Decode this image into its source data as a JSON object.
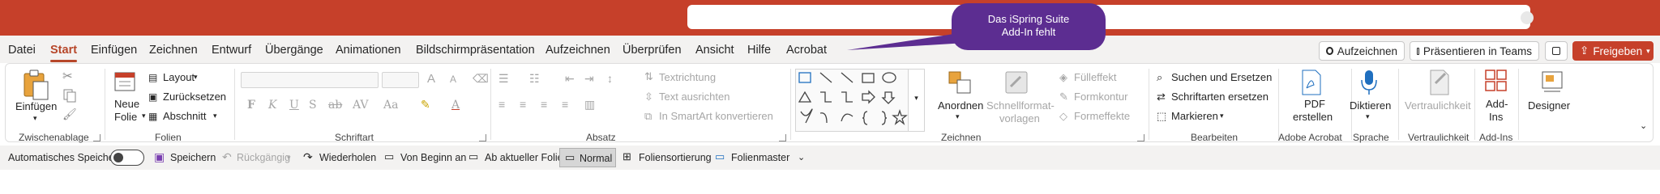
{
  "callout": {
    "line1": "Das iSpring Suite",
    "line2": "Add-In fehlt"
  },
  "tabs": [
    "Datei",
    "Start",
    "Einfügen",
    "Zeichnen",
    "Entwurf",
    "Übergänge",
    "Animationen",
    "Bildschirmpräsentation",
    "Aufzeichnen",
    "Überprüfen",
    "Ansicht",
    "Hilfe",
    "Acrobat"
  ],
  "active_tab": "Start",
  "top_buttons": {
    "record": "Aufzeichnen",
    "present_teams": "Präsentieren in Teams",
    "share": "Freigeben"
  },
  "groups": {
    "clipboard": {
      "label": "Zwischenablage",
      "paste": "Einfügen"
    },
    "slides": {
      "label": "Folien",
      "new_slide_1": "Neue",
      "new_slide_2": "Folie",
      "layout": "Layout",
      "reset": "Zurücksetzen",
      "section": "Abschnitt"
    },
    "font": {
      "label": "Schriftart",
      "bold": "F",
      "italic": "K",
      "underline": "U",
      "shadow": "S",
      "strike": "ab",
      "spacing": "AV",
      "case": "Aa",
      "grow": "A",
      "shrink": "A",
      "color": "A"
    },
    "paragraph": {
      "label": "Absatz",
      "text_direction": "Textrichtung",
      "align_text": "Text ausrichten",
      "smartart": "In SmartArt konvertieren"
    },
    "drawing": {
      "label": "Zeichnen",
      "arrange": "Anordnen",
      "quick_styles_1": "Schnellformat-",
      "quick_styles_2": "vorlagen",
      "fill": "Fülleffekt",
      "outline": "Formkontur",
      "effects": "Formeffekte"
    },
    "editing": {
      "label": "Bearbeiten",
      "find": "Suchen und Ersetzen",
      "replace_fonts": "Schriftarten ersetzen",
      "select": "Markieren"
    },
    "acrobat": {
      "label": "Adobe Acrobat",
      "pdf_1": "PDF",
      "pdf_2": "erstellen"
    },
    "voice": {
      "label": "Sprache",
      "dictate": "Diktieren"
    },
    "sensitivity": {
      "label": "Vertraulichkeit",
      "btn": "Vertraulichkeit"
    },
    "addins": {
      "label": "Add-Ins",
      "btn_1": "Add-",
      "btn_2": "Ins"
    },
    "designer": {
      "btn": "Designer"
    }
  },
  "qat": {
    "autosave": "Automatisches Speichern",
    "save": "Speichern",
    "undo": "Rückgängig",
    "redo": "Wiederholen",
    "from_start": "Von Beginn an",
    "from_current": "Ab aktueller Folie",
    "normal": "Normal",
    "sorter": "Foliensortierung",
    "master": "Folienmaster"
  },
  "colors": {
    "brand": "#c6402a",
    "active_tab": "#b7472a",
    "callout": "#5c2d91"
  }
}
